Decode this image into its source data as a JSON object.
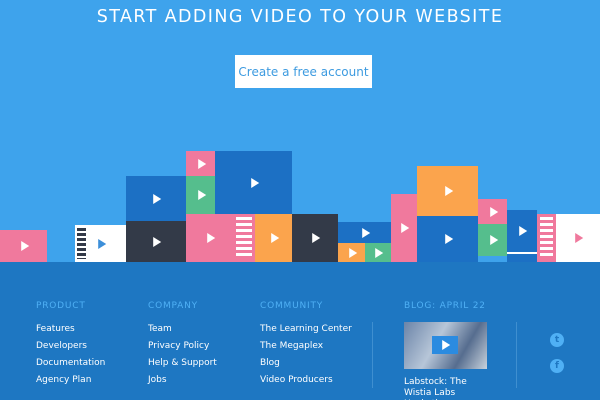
{
  "hero": {
    "title": "START ADDING VIDEO TO YOUR WEBSITE",
    "cta_label": "Create a free account"
  },
  "colors": {
    "sky": "#3ea3ec",
    "footer": "#1e77c2",
    "pink": "#f0799d",
    "green": "#55be8d",
    "orange": "#fba44d",
    "darkblue": "#1c70c4",
    "navy": "#333a48",
    "white": "#ffffff"
  },
  "footer": {
    "product": {
      "heading": "PRODUCT",
      "links": [
        "Features",
        "Developers",
        "Documentation",
        "Agency Plan"
      ]
    },
    "company": {
      "heading": "COMPANY",
      "links": [
        "Team",
        "Privacy Policy",
        "Help & Support",
        "Jobs"
      ]
    },
    "community": {
      "heading": "COMMUNITY",
      "links": [
        "The Learning Center",
        "The Megaplex",
        "Blog",
        "Video Producers"
      ]
    },
    "blog": {
      "heading": "BLOG: APRIL 22",
      "caption": "Labstock: The Wistia Labs Hackathon"
    },
    "social": [
      "twitter-icon",
      "facebook-icon"
    ]
  }
}
